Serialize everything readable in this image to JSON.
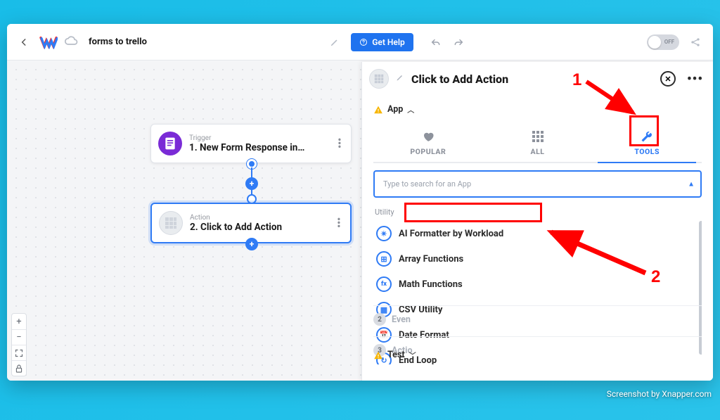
{
  "header": {
    "workflow_title": "forms to trello",
    "get_help": "Get Help",
    "toggle_label": "OFF"
  },
  "canvas": {
    "trigger": {
      "label": "Trigger",
      "title": "1. New Form Response in…"
    },
    "action": {
      "label": "Action",
      "title": "2. Click to Add Action"
    }
  },
  "panel": {
    "title": "Click to Add Action",
    "section_app": "App",
    "tabs": {
      "popular": "POPULAR",
      "all": "ALL",
      "tools": "TOOLS"
    },
    "search_placeholder": "Type to search for an App",
    "utility_label": "Utility",
    "apps": [
      {
        "name": "AI Formatter by Workload",
        "glyph": "✴"
      },
      {
        "name": "Array Functions",
        "glyph": "⊞"
      },
      {
        "name": "Math Functions",
        "glyph": "fx"
      },
      {
        "name": "CSV Utility",
        "glyph": "▦"
      },
      {
        "name": "Date Format",
        "glyph": "📅"
      },
      {
        "name": "End Loop",
        "glyph": "↻"
      }
    ],
    "section_event": "Even",
    "section_action": "Actio",
    "section_test": "Test"
  },
  "annotations": {
    "one": "1",
    "two": "2"
  },
  "watermark": "Screenshot by Xnapper.com"
}
